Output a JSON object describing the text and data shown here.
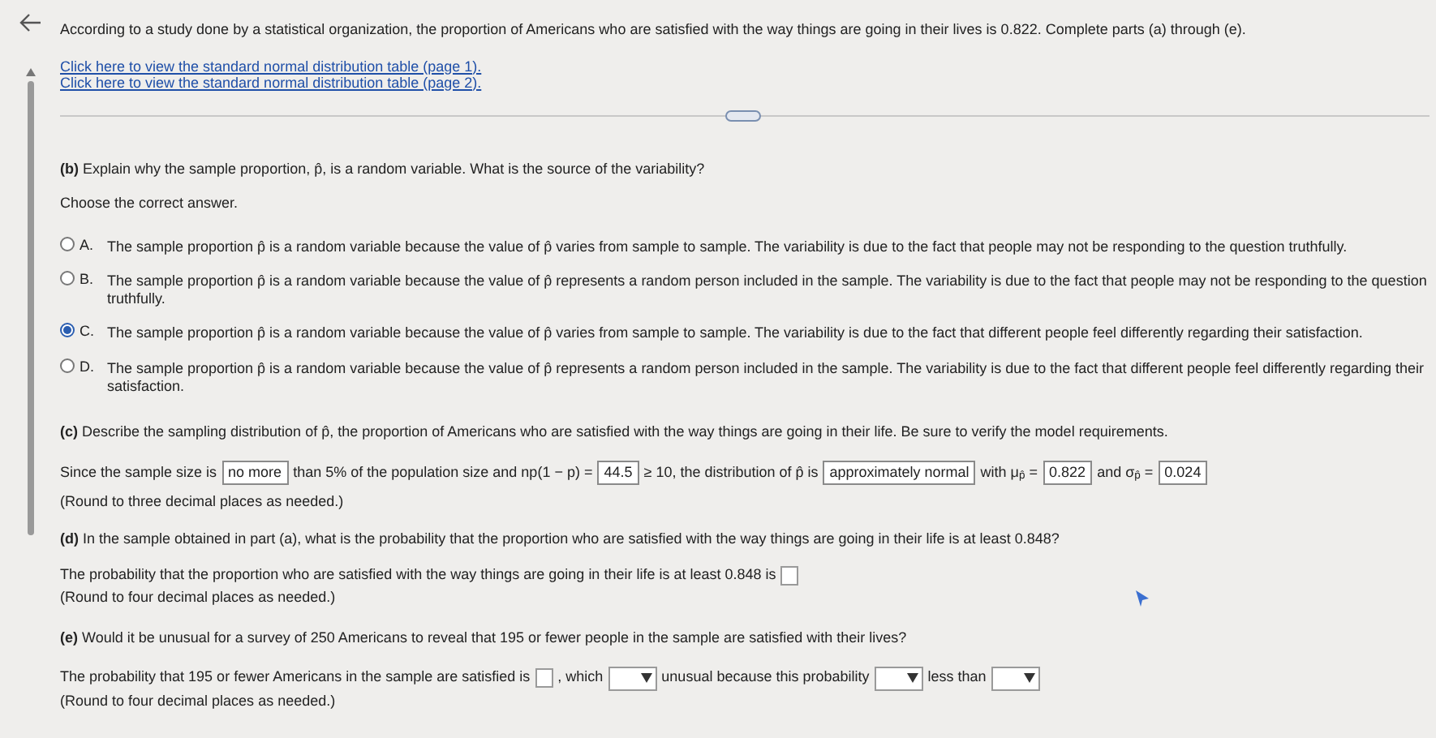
{
  "intro": {
    "text": "According to a study done by a statistical organization, the proportion of Americans who are satisfied with the way things are going in their lives is 0.822. Complete parts (a) through (e).",
    "links": [
      "Click here to view the standard normal distribution table (page 1).",
      "Click here to view the standard normal distribution table (page 2)."
    ]
  },
  "part_b": {
    "question": "**(b)** Explain why the sample proportion, p̂, is a random variable. What is the source of the variability?",
    "instruction": "Choose the correct answer.",
    "options": [
      {
        "letter": "A.",
        "text": "The sample proportion p̂ is a random variable because the value of p̂ varies from sample to sample. The variability is due to the fact that people may not be responding to the question truthfully.",
        "selected": false
      },
      {
        "letter": "B.",
        "text": "The sample proportion p̂ is a random variable because the value of p̂ represents a random person included in the sample. The variability is due to the fact that people may not be responding to the question truthfully.",
        "selected": false
      },
      {
        "letter": "C.",
        "text": "The sample proportion p̂ is a random variable because the value of p̂ varies from sample to sample. The variability is due to the fact that different people feel differently regarding their satisfaction.",
        "selected": true
      },
      {
        "letter": "D.",
        "text": "The sample proportion p̂ is a random variable because the value of p̂ represents a random person included in the sample. The variability is due to the fact that different people feel differently regarding their satisfaction.",
        "selected": false
      }
    ]
  },
  "part_c": {
    "question": "**(c)** Describe the sampling distribution of p̂, the proportion of Americans who are satisfied with the way things are going in their life. Be sure to verify the model requirements.",
    "segments": [
      {
        "kind": "text",
        "text": "Since the sample size is"
      },
      {
        "kind": "answer",
        "text": "no more"
      },
      {
        "kind": "text",
        "text": "than 5% of the population size and np(1 − p) ="
      },
      {
        "kind": "answer",
        "text": "44.5"
      },
      {
        "kind": "text",
        "text": "≥ 10, the distribution of p̂ is"
      },
      {
        "kind": "answer",
        "text": "approximately normal"
      },
      {
        "kind": "text",
        "text": "with μ$_{p̂}$ ="
      },
      {
        "kind": "answer",
        "text": "0.822"
      },
      {
        "kind": "text",
        "text": "and σ$_{p̂}$ ="
      },
      {
        "kind": "answer",
        "text": "0.024"
      }
    ],
    "note": "(Round to three decimal places as needed.)"
  },
  "part_d": {
    "question": "**(d)** In the sample obtained in part (a), what is the probability that the proportion who are satisfied with the way things are going in their life is at least 0.848?",
    "segments": [
      {
        "kind": "text",
        "text": "The probability that the proportion who are satisfied with the way things are going in their life is at least 0.848 is"
      },
      {
        "kind": "blank"
      }
    ],
    "note": "(Round to four decimal places as needed.)"
  },
  "part_e": {
    "question": "**(e)** Would it be unusual for a survey of 250 Americans to reveal that 195 or fewer people in the sample are satisfied with their lives?",
    "segments": [
      {
        "kind": "text",
        "text": "The probability that 195 or fewer Americans in the sample are satisfied is"
      },
      {
        "kind": "blank"
      },
      {
        "kind": "text",
        "text": ", which"
      },
      {
        "kind": "select"
      },
      {
        "kind": "text",
        "text": "unusual because this probability"
      },
      {
        "kind": "select"
      },
      {
        "kind": "text",
        "text": "less than"
      },
      {
        "kind": "select"
      }
    ],
    "note": "(Round to four decimal places as needed.)"
  }
}
